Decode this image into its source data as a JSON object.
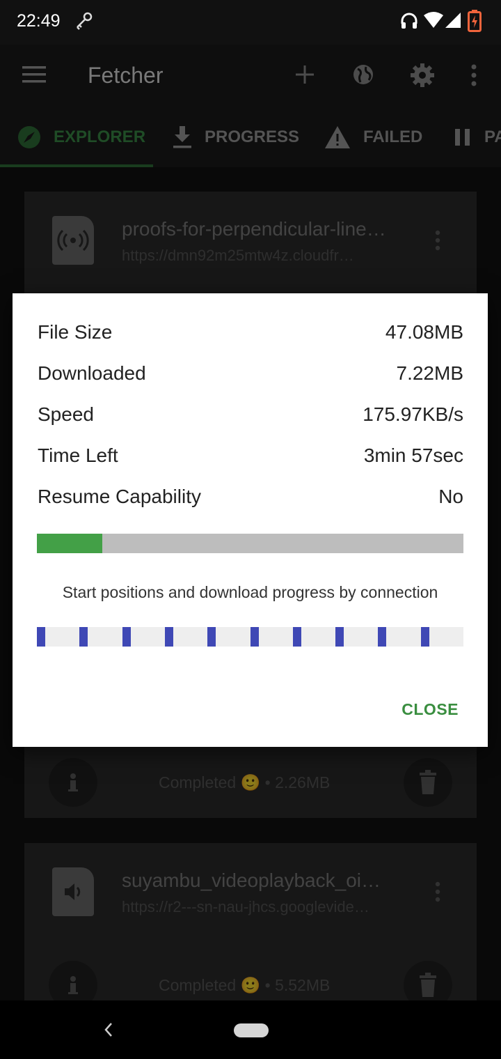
{
  "status_bar": {
    "time": "22:49"
  },
  "toolbar": {
    "title": "Fetcher"
  },
  "tabs": [
    {
      "label": "EXPLORER"
    },
    {
      "label": "PROGRESS"
    },
    {
      "label": "FAILED"
    },
    {
      "label": "PA"
    }
  ],
  "downloads": [
    {
      "title": "proofs-for-perpendicular-line…",
      "url": "https://dmn92m25mtw4z.cloudfr…",
      "status": "Completed 🙂 • 2.26MB"
    },
    {
      "title": "suyambu_videoplayback_oi…",
      "url": "https://r2---sn-nau-jhcs.googlevide…",
      "status": "Completed 🙂 • 5.52MB"
    }
  ],
  "dialog": {
    "rows": [
      {
        "label": "File Size",
        "value": "47.08MB"
      },
      {
        "label": "Downloaded",
        "value": "7.22MB"
      },
      {
        "label": "Speed",
        "value": "175.97KB/s"
      },
      {
        "label": "Time Left",
        "value": "3min 57sec"
      },
      {
        "label": "Resume Capability",
        "value": "No"
      }
    ],
    "progress_fraction": 0.153,
    "connections_caption": "Start positions and download progress by connection",
    "connection_start_fractions": [
      0.0,
      0.1,
      0.2,
      0.3,
      0.4,
      0.5,
      0.6,
      0.7,
      0.8,
      0.9
    ],
    "close_label": "CLOSE"
  },
  "colors": {
    "accent_green": "#43a047",
    "connection_blue": "#3f48b5"
  }
}
